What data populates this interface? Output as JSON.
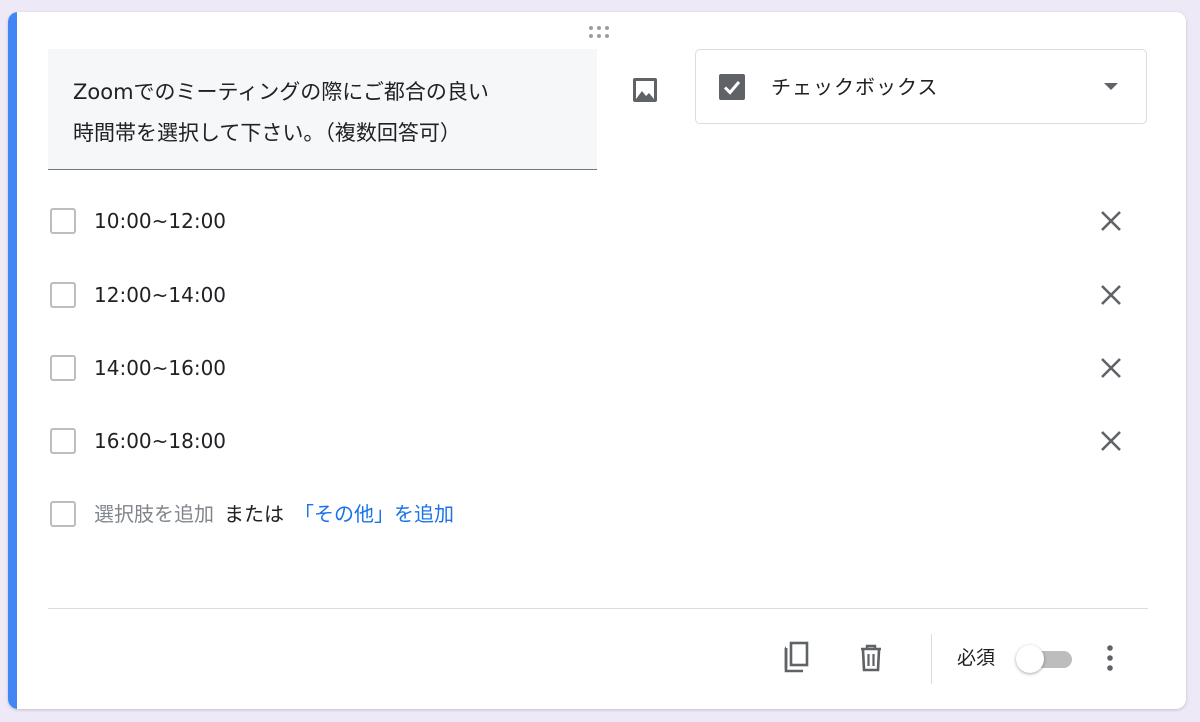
{
  "question": {
    "title_line1": "Zoomでのミーティングの際にご都合の良い",
    "title_line2": "時間帯を選択して下さい。（複数回答可）"
  },
  "question_type": {
    "label": "チェックボックス",
    "icon": "checkbox-checked-icon"
  },
  "options": [
    {
      "label": "10:00~12:00"
    },
    {
      "label": "12:00~14:00"
    },
    {
      "label": "14:00~16:00"
    },
    {
      "label": "16:00~18:00"
    }
  ],
  "add_option": {
    "add_choice_label": "選択肢を追加",
    "or_label": "または",
    "add_other_label": "「その他」を追加"
  },
  "footer": {
    "required_label": "必須",
    "required_on": false
  },
  "icons": {
    "image": "image-icon",
    "remove": "close-icon",
    "duplicate": "copy-icon",
    "delete": "trash-icon",
    "more": "more-vert-icon",
    "drag": "drag-handle-icon"
  },
  "colors": {
    "accent": "#4285f4",
    "link": "#1a73e8",
    "background": "#ede9f6"
  }
}
